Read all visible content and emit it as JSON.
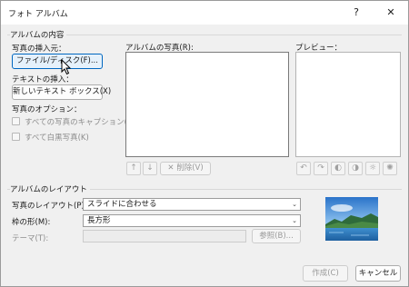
{
  "window": {
    "title": "フォト アルバム",
    "help": "?",
    "close": "✕"
  },
  "album_content": {
    "group_label": "アルバムの内容",
    "insert_from_label": "写真の挿入元：",
    "file_disk_button": "ファイル/ディスク(F)...",
    "insert_text_label": "テキストの挿入：",
    "new_textbox_button": "新しいテキスト ボックス(X)",
    "photo_options_label": "写真のオプション：",
    "caption_checkbox": "すべての写真のキャプション(A)",
    "bw_checkbox": "すべて白黒写真(K)",
    "album_photos_label": "アルバムの写真(R):",
    "delete_button": "削除(V)",
    "preview_label": "プレビュー："
  },
  "album_layout": {
    "group_label": "アルバムのレイアウト",
    "picture_layout_label": "写真のレイアウト(P):",
    "picture_layout_value": "スライドに合わせる",
    "frame_shape_label": "枠の形(M):",
    "frame_shape_value": "長方形",
    "theme_label": "テーマ(T):",
    "theme_value": "",
    "browse_button": "参照(B)..."
  },
  "footer": {
    "create_button": "作成(C)",
    "cancel_button": "キャンセル"
  },
  "colors": {
    "accent": "#0067c0",
    "dialog_bg": "#f0f0f0",
    "disabled_text": "#8c8c8c"
  },
  "icons": {
    "move_up": "arrow-up-icon",
    "move_down": "arrow-down-icon",
    "delete": "x-icon",
    "rotate_left": "rotate-left-icon",
    "rotate_right": "rotate-right-icon",
    "contrast_up": "contrast-up-icon",
    "contrast_down": "contrast-down-icon",
    "brightness_up": "brightness-up-icon",
    "brightness_down": "brightness-down-icon"
  }
}
